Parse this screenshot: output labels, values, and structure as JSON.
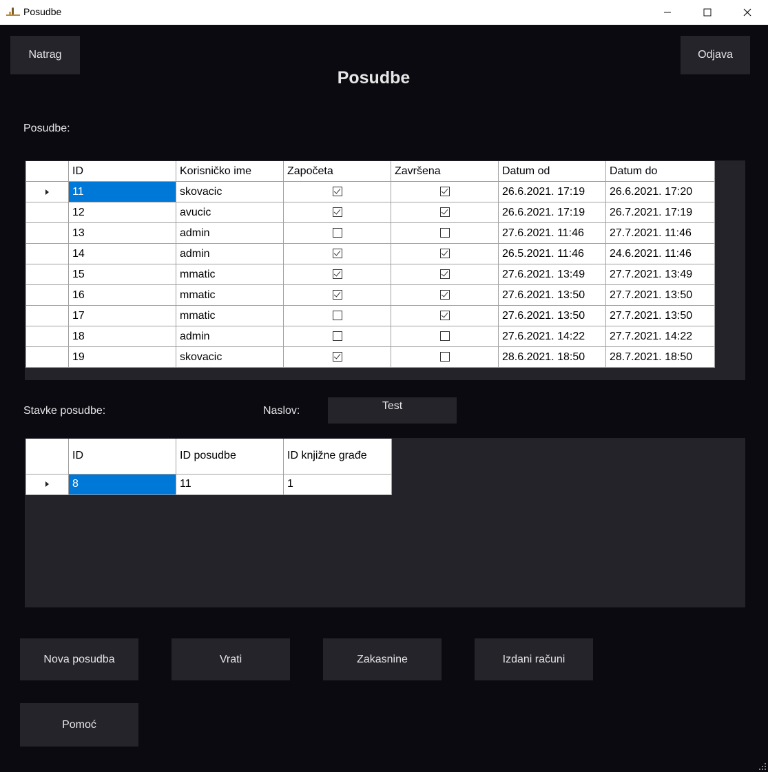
{
  "window": {
    "title": "Posudbe"
  },
  "header": {
    "back_label": "Natrag",
    "logout_label": "Odjava",
    "page_title": "Posudbe"
  },
  "loans": {
    "section_label": "Posudbe:",
    "columns": [
      "ID",
      "Korisničko ime",
      "Započeta",
      "Završena",
      "Datum od",
      "Datum do"
    ],
    "rows": [
      {
        "id": "11",
        "username": "skovacic",
        "started": true,
        "finished": true,
        "date_from": "26.6.2021. 17:19",
        "date_to": "26.6.2021. 17:20",
        "selected": true
      },
      {
        "id": "12",
        "username": "avucic",
        "started": true,
        "finished": true,
        "date_from": "26.6.2021. 17:19",
        "date_to": "26.7.2021. 17:19"
      },
      {
        "id": "13",
        "username": "admin",
        "started": false,
        "finished": false,
        "date_from": "27.6.2021. 11:46",
        "date_to": "27.7.2021. 11:46"
      },
      {
        "id": "14",
        "username": "admin",
        "started": true,
        "finished": true,
        "date_from": "26.5.2021. 11:46",
        "date_to": "24.6.2021. 11:46"
      },
      {
        "id": "15",
        "username": "mmatic",
        "started": true,
        "finished": true,
        "date_from": "27.6.2021. 13:49",
        "date_to": "27.7.2021. 13:49"
      },
      {
        "id": "16",
        "username": "mmatic",
        "started": true,
        "finished": true,
        "date_from": "27.6.2021. 13:50",
        "date_to": "27.7.2021. 13:50"
      },
      {
        "id": "17",
        "username": "mmatic",
        "started": false,
        "finished": true,
        "date_from": "27.6.2021. 13:50",
        "date_to": "27.7.2021. 13:50"
      },
      {
        "id": "18",
        "username": "admin",
        "started": false,
        "finished": false,
        "date_from": "27.6.2021. 14:22",
        "date_to": "27.7.2021. 14:22"
      },
      {
        "id": "19",
        "username": "skovacic",
        "started": true,
        "finished": false,
        "date_from": "28.6.2021. 18:50",
        "date_to": "28.7.2021. 18:50"
      }
    ]
  },
  "items": {
    "section_label": "Stavke posudbe:",
    "title_label": "Naslov:",
    "title_value": "Test",
    "columns": [
      "ID",
      "ID posudbe",
      "ID knjižne građe"
    ],
    "rows": [
      {
        "id": "8",
        "loan_id": "11",
        "material_id": "1",
        "selected": true
      }
    ]
  },
  "actions": {
    "new_loan": "Nova posudba",
    "return": "Vrati",
    "late_fees": "Zakasnine",
    "issued_invoices": "Izdani računi",
    "help": "Pomoć"
  },
  "colors": {
    "background": "#0b0a11",
    "button": "#25242b",
    "selection": "#0078d7"
  }
}
